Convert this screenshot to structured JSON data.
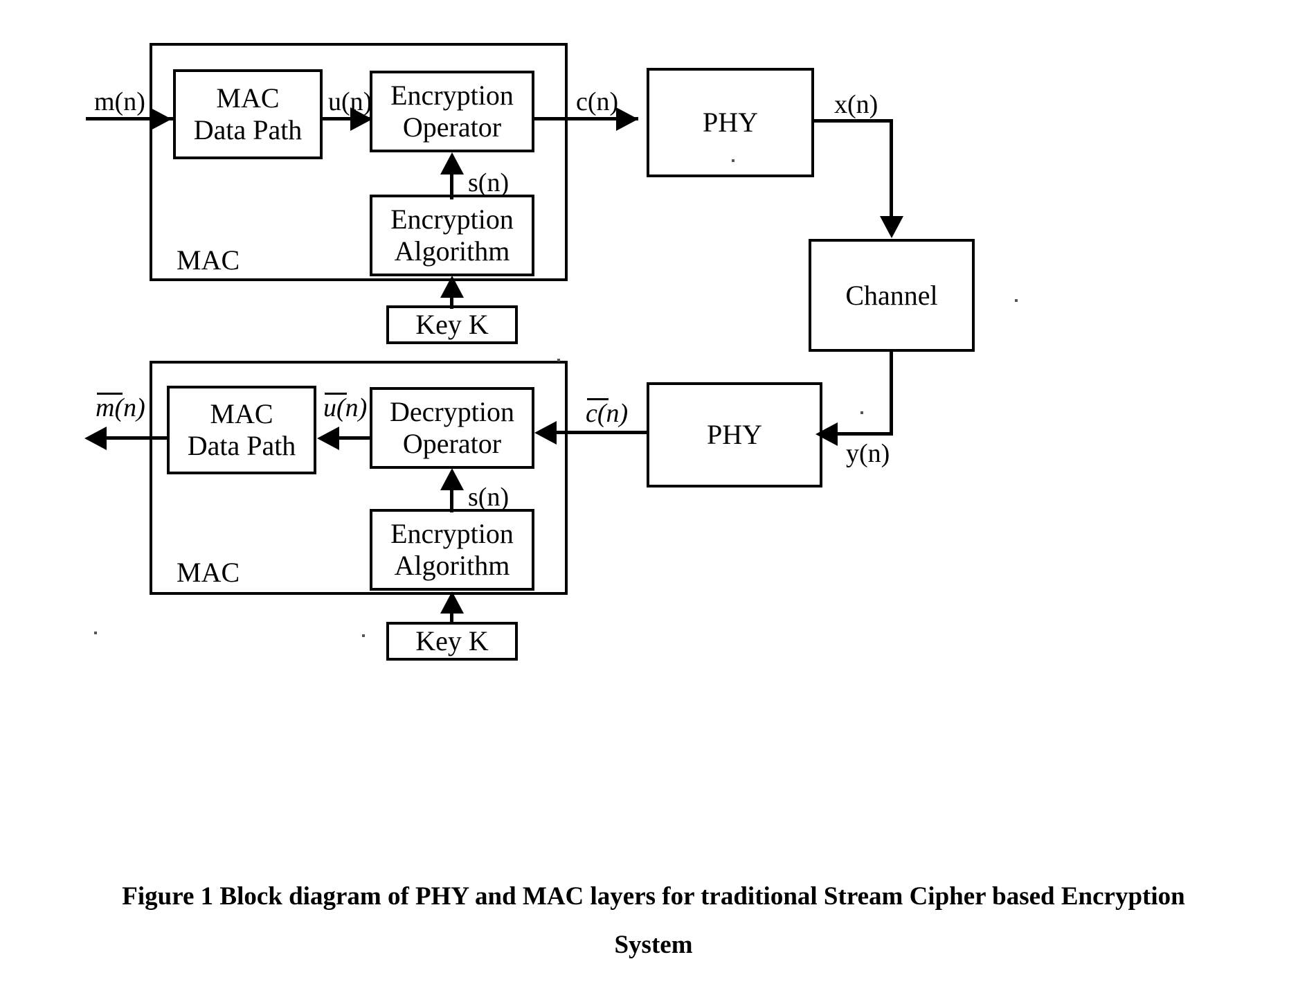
{
  "figure": {
    "caption_line1": "Figure 1 Block diagram of PHY and MAC layers for traditional Stream Cipher based Encryption",
    "caption_line2": "System"
  },
  "transmit": {
    "mac_container_label": "MAC",
    "mac_data_path_label": "MAC\nData Path",
    "encryption_operator_label": "Encryption\nOperator",
    "encryption_algorithm_label": "Encryption\nAlgorithm",
    "key_label": "Key K",
    "phy_label": "PHY",
    "signal_input": "m(n)",
    "signal_mac_out": "u(n)",
    "signal_keystream": "s(n)",
    "signal_cipher": "c(n)",
    "signal_phy_out": "x(n)"
  },
  "channel": {
    "label": "Channel"
  },
  "receive": {
    "mac_container_label": "MAC",
    "mac_data_path_label": "MAC\nData Path",
    "decryption_operator_label": "Decryption\nOperator",
    "encryption_algorithm_label": "Encryption\nAlgorithm",
    "key_label": "Key K",
    "phy_label": "PHY",
    "signal_output_m": "m(n)",
    "signal_mac_in_u": "u(n)",
    "signal_keystream": "s(n)",
    "signal_cipher_c": "c(n)",
    "signal_phy_in": "y(n)"
  },
  "colors": {
    "stroke": "#000000",
    "background": "#ffffff"
  }
}
